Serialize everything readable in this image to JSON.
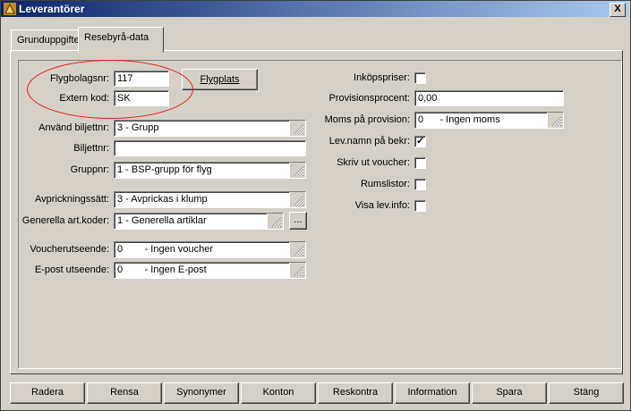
{
  "window": {
    "title": "Leverantörer",
    "close_glyph": "X"
  },
  "tabs": [
    {
      "label": "Grunduppgifter"
    },
    {
      "label": "Resebyrå-data"
    }
  ],
  "left": {
    "flygbolagsnr": {
      "label": "Flygbolagsnr:",
      "value": "117"
    },
    "extern_kod": {
      "label": "Extern kod:",
      "value": "SK"
    },
    "flygplats_button": "Flygplats",
    "anvand_biljettnr": {
      "label": "Använd biljettnr:",
      "value": "3  - Grupp"
    },
    "biljettnr": {
      "label": "Biljettnr:",
      "value": ""
    },
    "gruppnr": {
      "label": "Gruppnr:",
      "value": "1  - BSP-grupp för flyg"
    },
    "avprickningssatt": {
      "label": "Avprickningssätt:",
      "value": "3  - Avprickas i klump"
    },
    "generella_art_koder": {
      "label": "Generella art.koder:",
      "value": "1  - Generella artiklar",
      "ellipsis_label": "..."
    },
    "voucherutseende": {
      "label": "Voucherutseende:",
      "value": "0        - Ingen voucher"
    },
    "epost_utseende": {
      "label": "E-post utseende:",
      "value": "0        - Ingen E-post"
    }
  },
  "right": {
    "inkopspriser": {
      "label": "Inköpspriser:",
      "checked": false
    },
    "provisionsprocent": {
      "label": "Provisionsprocent:",
      "value": "0,00"
    },
    "moms_pa_provision": {
      "label": "Moms på provision:",
      "value": "0      - Ingen moms"
    },
    "lev_namn_pa_bekr": {
      "label": "Lev.namn på bekr:",
      "checked": true,
      "mark": "✓"
    },
    "skriv_ut_voucher": {
      "label": "Skriv ut voucher:",
      "checked": false
    },
    "rumslistor": {
      "label": "Rumslistor:",
      "checked": false
    },
    "visa_lev_info": {
      "label": "Visa lev.info:",
      "checked": false
    }
  },
  "buttons": [
    "Radera",
    "Rensa",
    "Synonymer",
    "Konton",
    "Reskontra",
    "Information",
    "Spara",
    "Stäng"
  ],
  "colors": {
    "titlebar_start": "#0a246a",
    "titlebar_end": "#a6caf0",
    "highlight_ellipse": "#e02020",
    "face": "#d4d0c8"
  }
}
